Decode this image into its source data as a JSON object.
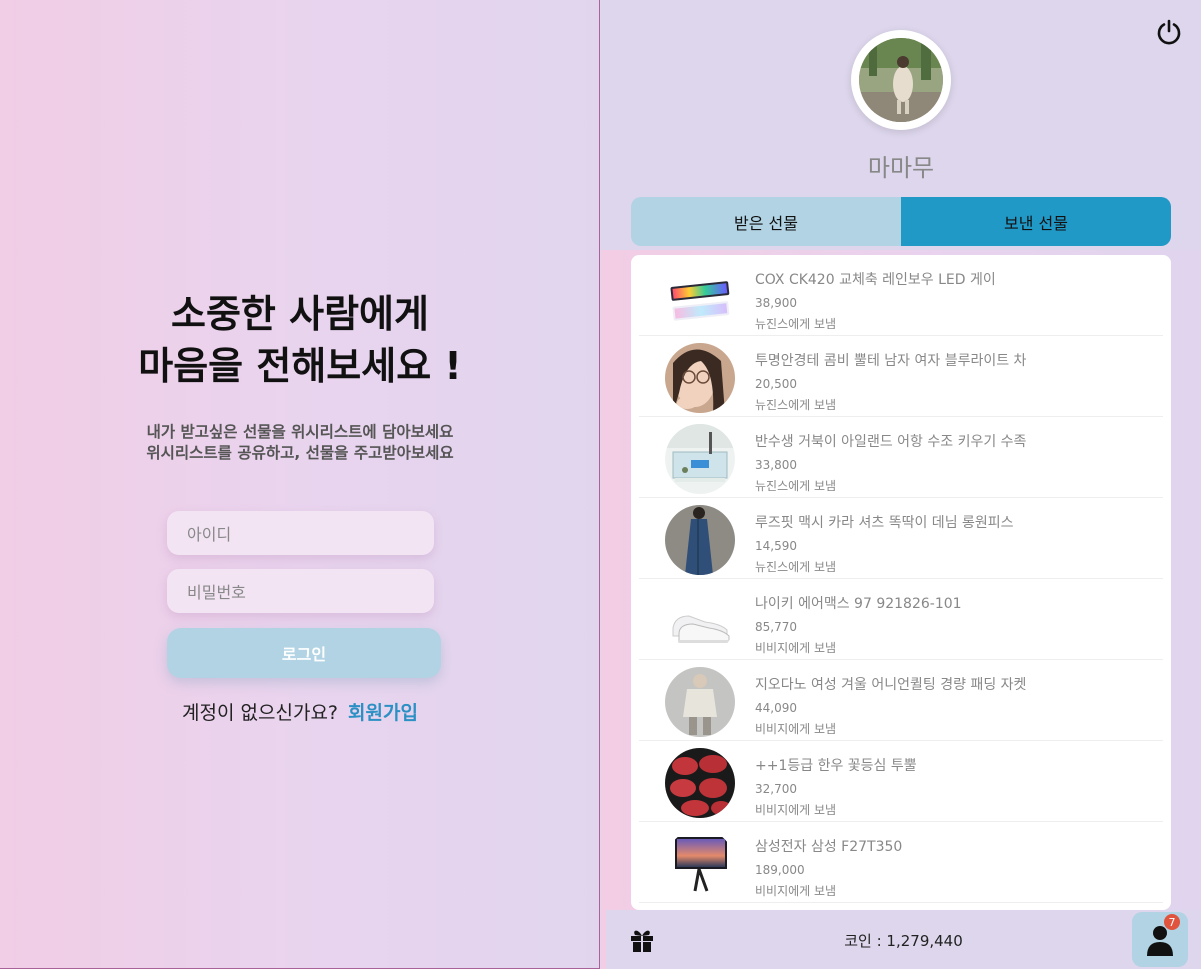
{
  "login": {
    "title_line1": "소중한 사람에게",
    "title_line2": "마음을 전해보세요 !",
    "subtitle_line1": "내가 받고싶은 선물을 위시리스트에 담아보세요",
    "subtitle_line2": "위시리스트를 공유하고, 선물을 주고받아보세요",
    "id_placeholder": "아이디",
    "pw_placeholder": "비밀번호",
    "login_label": "로그인",
    "signup_prompt": "계정이 없으신가요?",
    "signup_link": "회원가입"
  },
  "profile": {
    "name": "마마무"
  },
  "tabs": {
    "received": "받은 선물",
    "sent": "보낸 선물",
    "active": "sent"
  },
  "gifts": [
    {
      "name": "COX CK420 교체축 레인보우 LED 게이",
      "price": "38,900",
      "to": "뉴진스에게 보냄",
      "thumb": "keyboard"
    },
    {
      "name": "투명안경테 콤비 뿔테 남자 여자 블루라이트 차",
      "price": "20,500",
      "to": "뉴진스에게 보냄",
      "thumb": "glasses"
    },
    {
      "name": "반수생 거북이 아일랜드 어항 수조 키우기 수족",
      "price": "33,800",
      "to": "뉴진스에게 보냄",
      "thumb": "aquarium"
    },
    {
      "name": "루즈핏 맥시 카라 셔츠 똑딱이 데님 롱원피스",
      "price": "14,590",
      "to": "뉴진스에게 보냄",
      "thumb": "dress"
    },
    {
      "name": "나이키 에어맥스 97 921826-101",
      "price": "85,770",
      "to": "비비지에게 보냄",
      "thumb": "shoes"
    },
    {
      "name": "지오다노 여성 겨울 어니언퀼팅 경량 패딩 자켓",
      "price": "44,090",
      "to": "비비지에게 보냄",
      "thumb": "jacket"
    },
    {
      "name": "++1등급 한우 꽃등심 투뿔",
      "price": "32,700",
      "to": "비비지에게 보냄",
      "thumb": "beef"
    },
    {
      "name": "삼성전자 삼성 F27T350",
      "price": "189,000",
      "to": "비비지에게 보냄",
      "thumb": "monitor"
    }
  ],
  "footer": {
    "coin_text": "코인 : 1,279,440",
    "badge_count": "7"
  },
  "colors": {
    "accent": "#2199c7",
    "tab_inactive": "#b1d3e3",
    "link": "#2b90c4",
    "badge": "#e0533c"
  },
  "icons": [
    "power-icon",
    "gift-icon",
    "user-icon"
  ]
}
